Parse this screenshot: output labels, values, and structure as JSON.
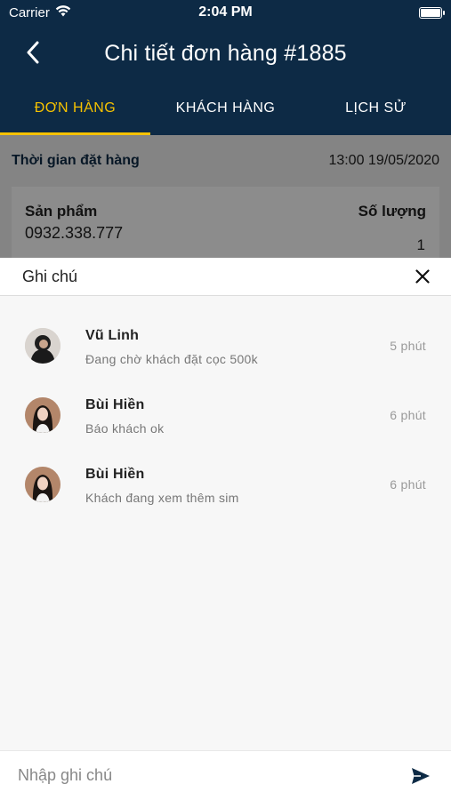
{
  "status_bar": {
    "carrier": "Carrier",
    "time": "2:04 PM"
  },
  "header": {
    "title": "Chi tiết đơn hàng #1885"
  },
  "tabs": [
    {
      "label": "ĐƠN HÀNG",
      "active": true
    },
    {
      "label": "KHÁCH HÀNG",
      "active": false
    },
    {
      "label": "LỊCH SỬ",
      "active": false
    }
  ],
  "order": {
    "time_label": "Thời gian đặt hàng",
    "time_value": "13:00 19/05/2020",
    "product_label": "Sản phẩm",
    "quantity_label": "Số lượng",
    "product_value": "0932.338.777",
    "quantity_value": "1"
  },
  "notes_sheet": {
    "title": "Ghi chú",
    "items": [
      {
        "name": "Vũ Linh",
        "text": "Đang chờ khách đặt cọc 500k",
        "time": "5 phút",
        "avatar": "avatar-dark"
      },
      {
        "name": "Bùi Hiền",
        "text": "Báo khách ok",
        "time": "6 phút",
        "avatar": "avatar-woman"
      },
      {
        "name": "Bùi Hiền",
        "text": "Khách đang xem thêm sim",
        "time": "6 phút",
        "avatar": "avatar-woman"
      }
    ],
    "input_placeholder": "Nhập ghi chú",
    "accent_color": "#0d2a45"
  },
  "colors": {
    "navy": "#0d2a45",
    "tab_active": "#f6c200"
  }
}
